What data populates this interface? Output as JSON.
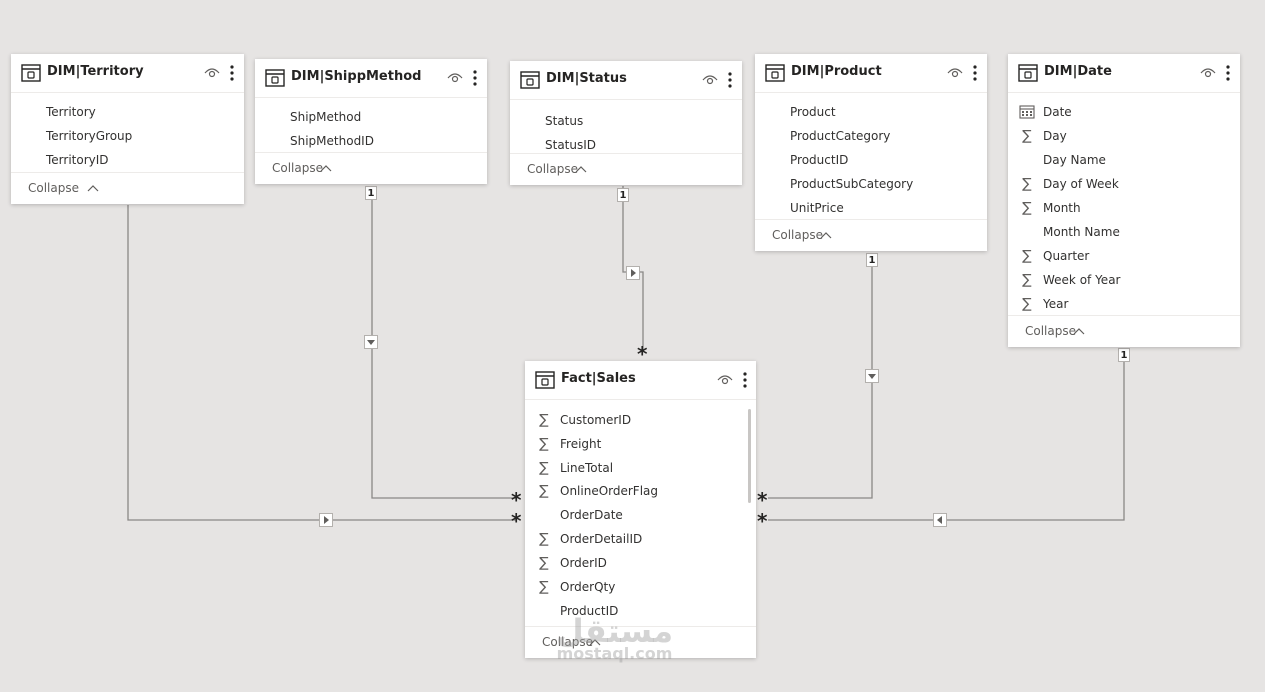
{
  "tables": {
    "territory": {
      "title": "DIM|Territory",
      "fields": [
        {
          "icon": "",
          "label": "Territory"
        },
        {
          "icon": "",
          "label": "TerritoryGroup"
        },
        {
          "icon": "",
          "label": "TerritoryID"
        }
      ],
      "collapse": "Collapse"
    },
    "shipmethod": {
      "title": "DIM|ShippMethod",
      "fields": [
        {
          "icon": "",
          "label": "ShipMethod"
        },
        {
          "icon": "",
          "label": "ShipMethodID"
        }
      ],
      "collapse": "Collapse"
    },
    "status": {
      "title": "DIM|Status",
      "fields": [
        {
          "icon": "",
          "label": "Status"
        },
        {
          "icon": "",
          "label": "StatusID"
        }
      ],
      "collapse": "Collapse"
    },
    "product": {
      "title": "DIM|Product",
      "fields": [
        {
          "icon": "",
          "label": "Product"
        },
        {
          "icon": "",
          "label": "ProductCategory"
        },
        {
          "icon": "",
          "label": "ProductID"
        },
        {
          "icon": "",
          "label": "ProductSubCategory"
        },
        {
          "icon": "",
          "label": "UnitPrice"
        }
      ],
      "collapse": "Collapse"
    },
    "date": {
      "title": "DIM|Date",
      "fields": [
        {
          "icon": "calendar",
          "label": "Date"
        },
        {
          "icon": "sigma",
          "label": "Day"
        },
        {
          "icon": "",
          "label": "Day Name"
        },
        {
          "icon": "sigma",
          "label": "Day of Week"
        },
        {
          "icon": "sigma",
          "label": "Month"
        },
        {
          "icon": "",
          "label": "Month Name"
        },
        {
          "icon": "sigma",
          "label": "Quarter"
        },
        {
          "icon": "sigma",
          "label": "Week of Year"
        },
        {
          "icon": "sigma",
          "label": "Year"
        }
      ],
      "collapse": "Collapse"
    },
    "sales": {
      "title": "Fact|Sales",
      "fields": [
        {
          "icon": "sigma",
          "label": "CustomerID"
        },
        {
          "icon": "sigma",
          "label": "Freight"
        },
        {
          "icon": "sigma",
          "label": "LineTotal"
        },
        {
          "icon": "sigma",
          "label": "OnlineOrderFlag"
        },
        {
          "icon": "",
          "label": "OrderDate"
        },
        {
          "icon": "sigma",
          "label": "OrderDetailID"
        },
        {
          "icon": "sigma",
          "label": "OrderID"
        },
        {
          "icon": "sigma",
          "label": "OrderQty"
        },
        {
          "icon": "",
          "label": "ProductID"
        }
      ],
      "collapse": "Collapse"
    }
  },
  "relationships": {
    "one": "1",
    "many": "*"
  },
  "watermark": {
    "arabic": "مستقل",
    "latin": "mostaql.com"
  },
  "colors": {
    "canvas": "#e6e4e3",
    "card": "#ffffff",
    "line": "#8a8886"
  }
}
